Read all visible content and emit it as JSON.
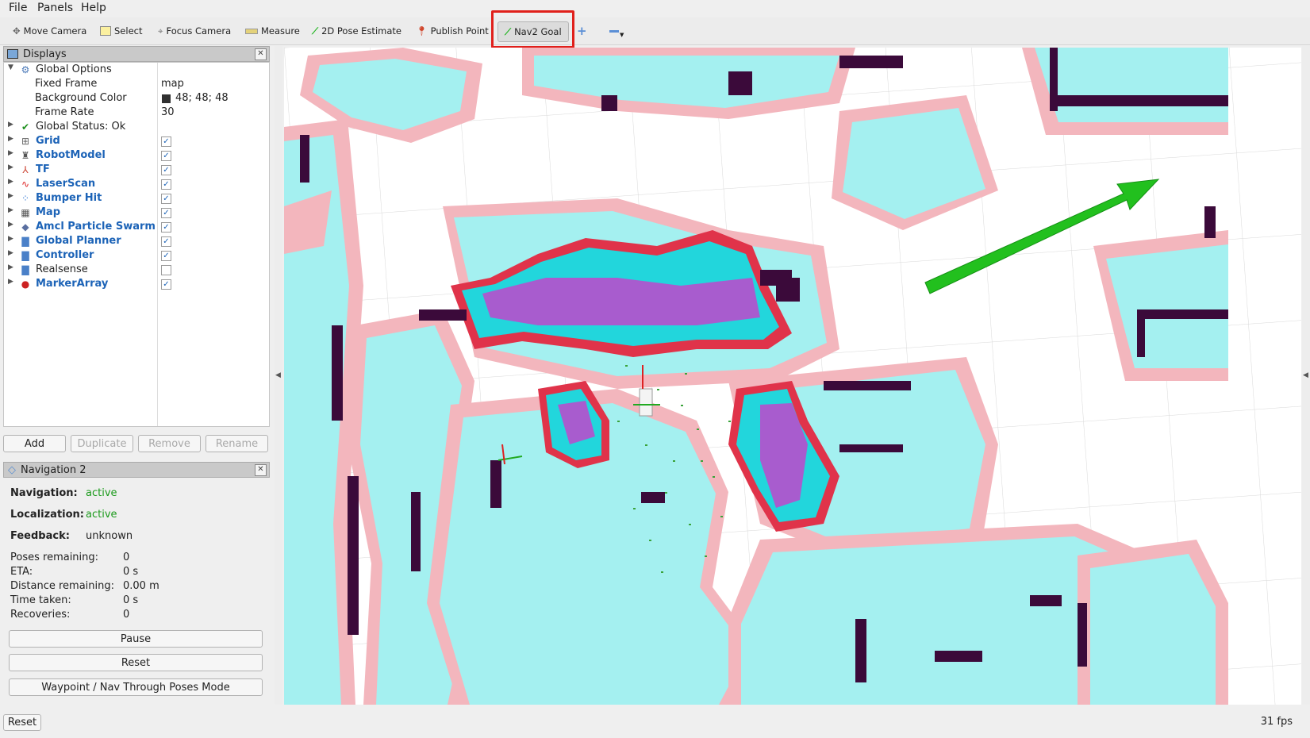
{
  "menu": [
    "File",
    "Panels",
    "Help"
  ],
  "toolbar": {
    "tools": [
      "Move Camera",
      "Select",
      "Focus Camera",
      "Measure",
      "2D Pose Estimate",
      "Publish Point",
      "Nav2 Goal"
    ]
  },
  "displays": {
    "title": "Displays",
    "global_options": "Global Options",
    "fixed_frame_label": "Fixed Frame",
    "fixed_frame_value": "map",
    "bg_color_label": "Background Color",
    "bg_color_value": "48; 48; 48",
    "frame_rate_label": "Frame Rate",
    "frame_rate_value": "30",
    "global_status": "Global Status: Ok",
    "items": [
      {
        "name": "Grid",
        "checked": true
      },
      {
        "name": "RobotModel",
        "checked": true
      },
      {
        "name": "TF",
        "checked": true
      },
      {
        "name": "LaserScan",
        "checked": true
      },
      {
        "name": "Bumper Hit",
        "checked": true
      },
      {
        "name": "Map",
        "checked": true
      },
      {
        "name": "Amcl Particle Swarm",
        "checked": true
      },
      {
        "name": "Global Planner",
        "checked": true
      },
      {
        "name": "Controller",
        "checked": true
      },
      {
        "name": "Realsense",
        "checked": false
      },
      {
        "name": "MarkerArray",
        "checked": true
      }
    ],
    "buttons": {
      "add": "Add",
      "duplicate": "Duplicate",
      "remove": "Remove",
      "rename": "Rename"
    }
  },
  "nav2": {
    "title": "Navigation 2",
    "navigation_label": "Navigation:",
    "navigation_value": "active",
    "localization_label": "Localization:",
    "localization_value": "active",
    "feedback_label": "Feedback:",
    "feedback_value": "unknown",
    "poses_label": "Poses remaining:",
    "poses_value": "0",
    "eta_label": "ETA:",
    "eta_value": "0 s",
    "distance_label": "Distance remaining:",
    "distance_value": "0.00 m",
    "time_label": "Time taken:",
    "time_value": "0 s",
    "recoveries_label": "Recoveries:",
    "recoveries_value": "0",
    "pause": "Pause",
    "reset": "Reset",
    "mode": "Waypoint / Nav Through Poses Mode"
  },
  "status": {
    "reset": "Reset",
    "fps": "31 fps"
  },
  "colors": {
    "highlight": "#e0201b",
    "accent_blue": "#1c63b7",
    "active_green": "#1b9a1b",
    "costmap_cyan": "#a4f0f0",
    "inflation_pink": "#f3b6bd",
    "obstacle": "#3b0a3a",
    "goal_arrow": "#22c01e"
  }
}
